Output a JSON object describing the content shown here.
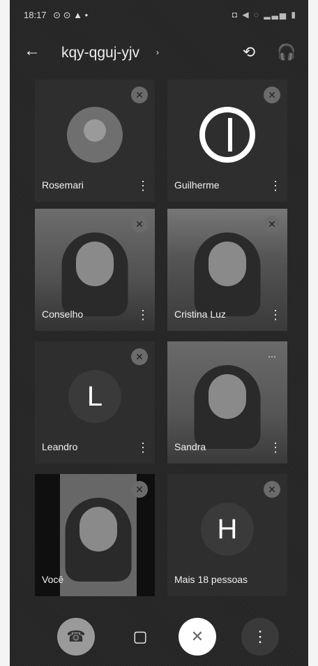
{
  "status": {
    "time": "18:17",
    "left_icons": "⊙ ⊙ ▲ •",
    "right_icons": "◘ ◀ ◌ ▂▃▅ ▮"
  },
  "header": {
    "meeting_code": "kqy-qguj-yjv",
    "chevron": "›",
    "back_icon": "←",
    "camera_switch_icon": "⟲",
    "audio_icon": "🎧"
  },
  "tiles": [
    {
      "name": "Rosemari",
      "type": "avatar"
    },
    {
      "name": "Guilherme",
      "type": "logo"
    },
    {
      "name": "Conselho",
      "type": "video"
    },
    {
      "name": "Cristina Luz",
      "type": "video"
    },
    {
      "name": "Leandro",
      "type": "letter",
      "letter": "L"
    },
    {
      "name": "Sandra",
      "type": "video"
    },
    {
      "name": "Você",
      "type": "video"
    },
    {
      "name": "Mais 18 pessoas",
      "type": "letter",
      "letter": "H"
    }
  ],
  "icons": {
    "dots": "⋮",
    "mute": "✕",
    "speaking": "⋯"
  },
  "controls": {
    "end": "☎",
    "camera": "▢",
    "mic": "✕",
    "more": "⋮"
  }
}
